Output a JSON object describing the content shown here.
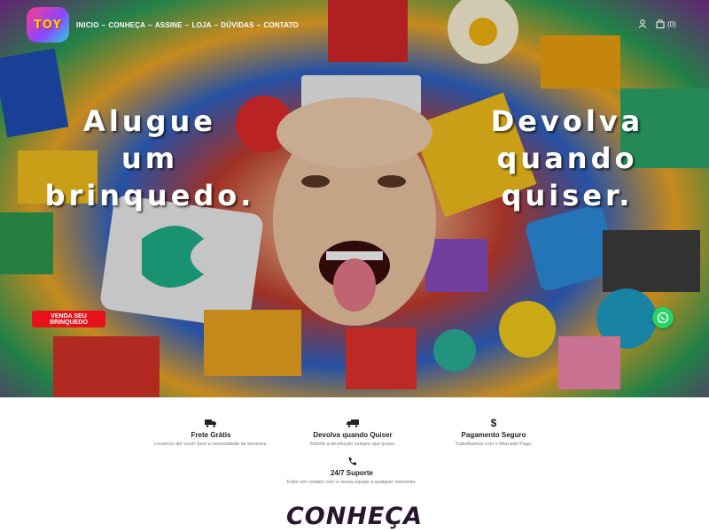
{
  "brand": {
    "logo_text": "TOY"
  },
  "nav": {
    "items": [
      {
        "label": "INICIO"
      },
      {
        "label": "CONHEÇA"
      },
      {
        "label": "ASSINE"
      },
      {
        "label": "LOJA"
      },
      {
        "label": "DÚVIDAS"
      },
      {
        "label": "CONTATO"
      }
    ],
    "separator": "–",
    "cart_count": "(0)"
  },
  "hero": {
    "left_lines": [
      "Alugue",
      "um",
      "brinquedo."
    ],
    "right_lines": [
      "Devolva",
      "quando",
      "quiser."
    ],
    "cta_label": "VENDA SEU BRINQUEDO"
  },
  "features": [
    {
      "icon": "truck-icon",
      "title": "Frete Grátis",
      "desc": "Levamos até você! Sem a necessidade de terceiros."
    },
    {
      "icon": "return-truck-icon",
      "title": "Devolva quando Quiser",
      "desc": "Solicite a devolução sempre que quiser."
    },
    {
      "icon": "dollar-icon",
      "title": "Pagamento Seguro",
      "desc": "Trabalhamos com o Mercado Pago."
    },
    {
      "icon": "phone-icon",
      "title": "24/7 Suporte",
      "desc": "Entre em contato com a nossa equipe a qualquer momento."
    }
  ],
  "section": {
    "title": "CONHEÇA"
  },
  "colors": {
    "cta": "#e8111a",
    "whatsapp": "#25d366",
    "section_title": "#2a1530"
  }
}
